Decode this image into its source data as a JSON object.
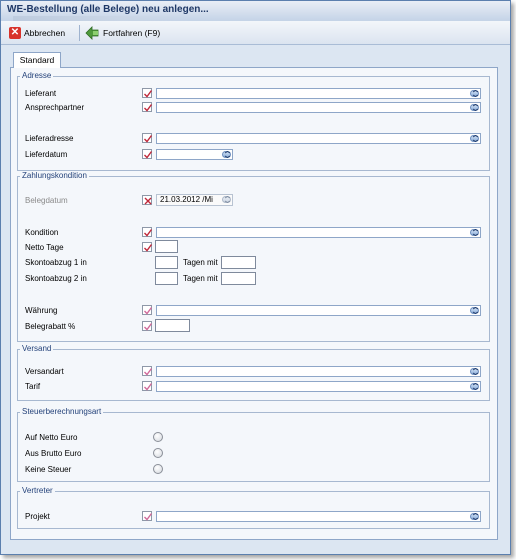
{
  "window": {
    "title": "WE-Bestellung (alle Belege) neu anlegen..."
  },
  "toolbar": {
    "cancel_label": "Abbrechen",
    "continue_label": "Fortfahren (F9)"
  },
  "tab": {
    "label": "Standard"
  },
  "groups": {
    "adresse": {
      "title": "Adresse",
      "lieferant": "Lieferant",
      "ansprechpartner": "Ansprechpartner",
      "lieferadresse": "Lieferadresse",
      "lieferdatum": "Lieferdatum"
    },
    "zahlung": {
      "title": "Zahlungskondition",
      "belegdatum": "Belegdatum",
      "belegdatum_value": "21.03.2012 /Mi",
      "kondition": "Kondition",
      "netto_tage": "Netto Tage",
      "skonto1": "Skontoabzug 1 in",
      "skonto2": "Skontoabzug 2 in",
      "tagen_mit": "Tagen mit",
      "waehrung": "Währung",
      "belegrabatt": "Belegrabatt %"
    },
    "versand": {
      "title": "Versand",
      "versandart": "Versandart",
      "tarif": "Tarif"
    },
    "steuer": {
      "title": "Steuerberechnungsart",
      "netto": "Auf Netto Euro",
      "brutto": "Aus Brutto Euro",
      "keine": "Keine Steuer"
    },
    "vertreter": {
      "title": "Vertreter",
      "projekt": "Projekt"
    }
  },
  "colors": {
    "accent": "#8ea6c8",
    "check_red": "#c0283a",
    "check_pink": "#d06a9a"
  },
  "icons": {
    "cancel": "close-icon",
    "continue": "continue-icon",
    "combo": "chevron-down-icon",
    "required": "check-icon"
  }
}
